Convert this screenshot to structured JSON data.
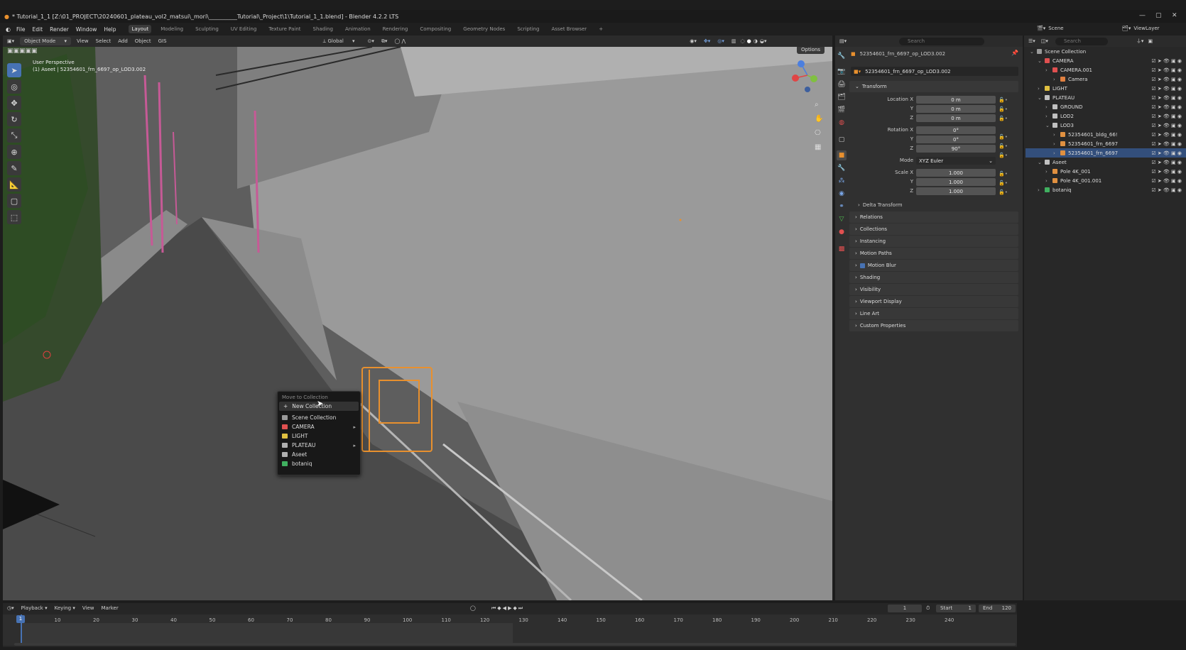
{
  "window": {
    "title": "* Tutorial_1_1 [Z:\\01_PROJECT\\20240601_plateau_vol2_matsui\\_mori\\__________Tutorial\\_Project\\1\\Tutorial_1_1.blend] - Blender 4.2.2 LTS"
  },
  "menu": [
    "File",
    "Edit",
    "Render",
    "Window",
    "Help"
  ],
  "workspaces": [
    "Layout",
    "Modeling",
    "Sculpting",
    "UV Editing",
    "Texture Paint",
    "Shading",
    "Animation",
    "Rendering",
    "Compositing",
    "Geometry Nodes",
    "Scripting",
    "Asset Browser"
  ],
  "workspace_add": "+",
  "viewport_header": {
    "mode": "Object Mode",
    "items": [
      "View",
      "Select",
      "Add",
      "Object",
      "GIS"
    ],
    "transform": "Global",
    "options": "Options"
  },
  "viewport": {
    "perspective": "User Perspective",
    "object_info": "(1) Aseet | 52354601_frn_6697_op_LOD3.002"
  },
  "context_menu": {
    "title": "Move to Collection",
    "items": [
      {
        "label": "New Collection",
        "icon": "plus-icon",
        "highlighted": true
      },
      {
        "label": "Scene Collection",
        "color": "#9a9a9a",
        "submenu": false
      },
      {
        "label": "CAMERA",
        "color": "#e05050",
        "submenu": true
      },
      {
        "label": "LIGHT",
        "color": "#e0c040",
        "submenu": false
      },
      {
        "label": "PLATEAU",
        "color": "#b0b0b0",
        "submenu": true
      },
      {
        "label": "Aseet",
        "color": "#b0b0b0",
        "submenu": false
      },
      {
        "label": "botaniq",
        "color": "#40b060",
        "submenu": false
      }
    ]
  },
  "properties": {
    "search_placeholder": "Search",
    "object_name": "52354601_frn_6697_op_LOD3.002",
    "object_field": "52354601_frn_6697_op_LOD3.002",
    "transform_label": "Transform",
    "location_label": "Location X",
    "location": [
      "0 m",
      "0 m",
      "0 m"
    ],
    "rotation_label": "Rotation X",
    "rotation": [
      "0°",
      "0°",
      "90°"
    ],
    "mode_label": "Mode",
    "mode_value": "XYZ Euler",
    "scale_label": "Scale X",
    "scale": [
      "1.000",
      "1.000",
      "1.000"
    ],
    "axis_y": "Y",
    "axis_z": "Z",
    "delta": "Delta Transform",
    "panels": [
      "Relations",
      "Collections",
      "Instancing",
      "Motion Paths",
      "Motion Blur",
      "Shading",
      "Visibility",
      "Viewport Display",
      "Line Art",
      "Custom Properties"
    ]
  },
  "outliner": {
    "scene_label": "Scene",
    "viewlayer_label": "ViewLayer",
    "search_placeholder": "Search",
    "rows": [
      {
        "label": "Scene Collection",
        "indent": 0,
        "color": "#9a9a9a"
      },
      {
        "label": "CAMERA",
        "indent": 1,
        "color": "#e05050"
      },
      {
        "label": "CAMERA.001",
        "indent": 2,
        "color": "#e05050"
      },
      {
        "label": "Camera",
        "indent": 3,
        "color": "#e08040"
      },
      {
        "label": "LIGHT",
        "indent": 1,
        "color": "#e0c040"
      },
      {
        "label": "PLATEAU",
        "indent": 1,
        "color": "#c0c0c0"
      },
      {
        "label": "GROUND",
        "indent": 2,
        "color": "#c0c0c0"
      },
      {
        "label": "LOD2",
        "indent": 2,
        "color": "#c0c0c0"
      },
      {
        "label": "LOD3",
        "indent": 2,
        "color": "#c0c0c0"
      },
      {
        "label": "52354601_bldg_66!",
        "indent": 3,
        "color": "#e09040"
      },
      {
        "label": "52354601_frn_6697",
        "indent": 3,
        "color": "#e09040"
      },
      {
        "label": "52354601_frn_6697",
        "indent": 3,
        "color": "#e09040",
        "selected": true
      },
      {
        "label": "Aseet",
        "indent": 1,
        "color": "#c0c0c0"
      },
      {
        "label": "Pole 4K_001",
        "indent": 2,
        "color": "#e09040"
      },
      {
        "label": "Pole 4K_001.001",
        "indent": 2,
        "color": "#e09040"
      },
      {
        "label": "botaniq",
        "indent": 1,
        "color": "#40b060"
      }
    ]
  },
  "timeline": {
    "menus": [
      "Playback",
      "Keying",
      "View",
      "Marker"
    ],
    "current_frame": "1",
    "start_label": "Start",
    "start": "1",
    "end_label": "End",
    "end": "120",
    "ticks": [
      "1",
      "10",
      "20",
      "30",
      "40",
      "50",
      "60",
      "70",
      "80",
      "90",
      "100",
      "110",
      "120",
      "130",
      "140",
      "150",
      "160",
      "170",
      "180",
      "190",
      "200",
      "210",
      "220",
      "230",
      "240"
    ]
  },
  "colors": {
    "accent": "#4772b3",
    "selection": "#e8902e",
    "rail_pink": "#c65a96"
  }
}
